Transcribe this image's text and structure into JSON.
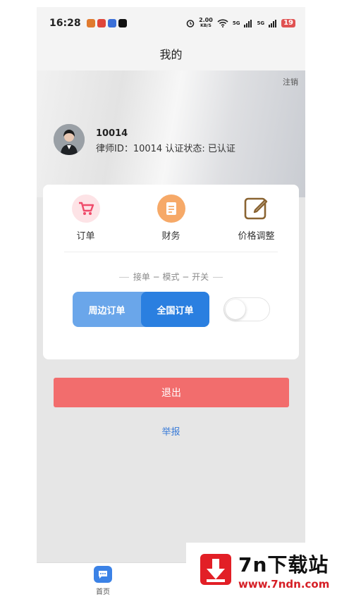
{
  "status_bar": {
    "time": "16:28",
    "net_speed": "2.00",
    "net_unit": "KB/S",
    "signal1": "5G",
    "signal2": "5G",
    "battery": "19"
  },
  "nav": {
    "title": "我的"
  },
  "profile": {
    "logout_link": "注销",
    "user_id": "10014",
    "info": "律师ID：10014   认证状态: 已认证"
  },
  "menu": {
    "items": [
      {
        "label": "订单",
        "icon": "cart-icon"
      },
      {
        "label": "财务",
        "icon": "document-icon"
      },
      {
        "label": "价格调整",
        "icon": "edit-icon"
      }
    ]
  },
  "mode": {
    "title": "接单 − 模式 − 开关",
    "options": [
      "周边订单",
      "全国订单"
    ],
    "selected": "全国订单",
    "toggle_on": false
  },
  "actions": {
    "logout_button": "退出",
    "report_link": "举报"
  },
  "tabbar": {
    "home_label": "首页"
  },
  "watermark": {
    "brand": "7n下载站",
    "url": "www.7ndn.com"
  },
  "colors": {
    "accent": "#2a7fe0",
    "danger": "#f26d6d",
    "link": "#3b7cd8"
  }
}
